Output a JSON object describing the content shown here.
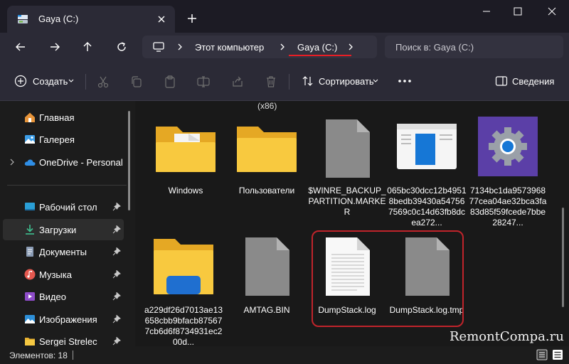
{
  "window": {
    "tab_title": "Gaya (C:)",
    "new_tab_icon": "plus-icon",
    "controls": [
      "minimize-icon",
      "maximize-icon",
      "close-icon"
    ]
  },
  "navigation": {
    "breadcrumb": [
      "Этот компьютер",
      "Gaya (C:)"
    ],
    "search_placeholder": "Поиск в: Gaya (C:)",
    "highlight_color": "#e81e25"
  },
  "toolbar": {
    "create_label": "Создать",
    "sort_label": "Сортировать",
    "details_label": "Сведения",
    "actions": [
      "cut-icon",
      "copy-icon",
      "paste-icon",
      "rename-icon",
      "share-icon",
      "delete-icon"
    ]
  },
  "sidebar": {
    "items": [
      {
        "label": "Главная",
        "icon": "home-icon"
      },
      {
        "label": "Галерея",
        "icon": "gallery-icon"
      },
      {
        "label": "OneDrive - Personal",
        "icon": "cloud-icon"
      },
      {
        "label": "Рабочий стол",
        "icon": "desktop-icon"
      },
      {
        "label": "Загрузки",
        "icon": "download-icon"
      },
      {
        "label": "Документы",
        "icon": "documents-icon"
      },
      {
        "label": "Музыка",
        "icon": "music-icon"
      },
      {
        "label": "Видео",
        "icon": "video-icon"
      },
      {
        "label": "Изображения",
        "icon": "pictures-icon"
      },
      {
        "label": "Sergei Strelec",
        "icon": "folder-icon"
      }
    ]
  },
  "content": {
    "partial_label": "(x86)",
    "items": [
      {
        "name": "Windows",
        "type": "folder"
      },
      {
        "name": "Пользователи",
        "type": "folder"
      },
      {
        "name": "$WINRE_BACKUP_PARTITION.MARKER",
        "type": "file"
      },
      {
        "name": "065bc30dcc12b49518bedb39430a547567569c0c14d63fb8dcea272...",
        "type": "app-window"
      },
      {
        "name": "7134bc1da957396877cea04ae32bca3fa83d85f59fcede7bbe28247...",
        "type": "gear"
      },
      {
        "name": "a229df26d7013ae13658cbb9bfacb875677cb6d6f8734931ec200d...",
        "type": "folder-blue"
      },
      {
        "name": "AMTAG.BIN",
        "type": "file"
      },
      {
        "name": "DumpStack.log",
        "type": "text-file"
      },
      {
        "name": "DumpStack.log.tmp",
        "type": "file"
      }
    ],
    "highlight_color": "#c0242b"
  },
  "status": {
    "count": "Элементов: 18",
    "watermark": "RemontCompa.ru"
  }
}
